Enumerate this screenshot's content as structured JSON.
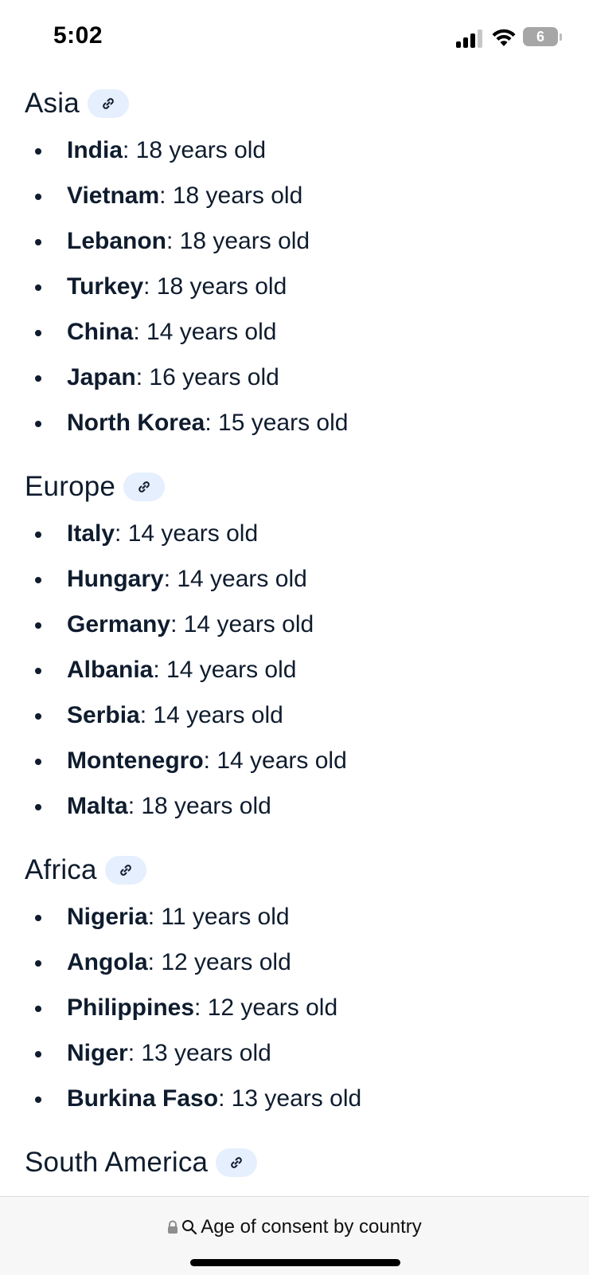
{
  "status_bar": {
    "time": "5:02",
    "battery": "6"
  },
  "sections": [
    {
      "title": "Asia",
      "items": [
        {
          "country": "India",
          "age": ": 18 years old"
        },
        {
          "country": "Vietnam",
          "age": ": 18 years old"
        },
        {
          "country": "Lebanon",
          "age": ": 18 years old"
        },
        {
          "country": "Turkey",
          "age": ": 18 years old"
        },
        {
          "country": "China",
          "age": ": 14 years old"
        },
        {
          "country": "Japan",
          "age": ": 16 years old"
        },
        {
          "country": "North Korea",
          "age": ": 15 years old"
        }
      ]
    },
    {
      "title": "Europe",
      "items": [
        {
          "country": "Italy",
          "age": ": 14 years old"
        },
        {
          "country": "Hungary",
          "age": ": 14 years old"
        },
        {
          "country": "Germany",
          "age": ": 14 years old"
        },
        {
          "country": "Albania",
          "age": ": 14 years old"
        },
        {
          "country": "Serbia",
          "age": ": 14 years old"
        },
        {
          "country": "Montenegro",
          "age": ": 14 years old"
        },
        {
          "country": "Malta",
          "age": ": 18 years old"
        }
      ]
    },
    {
      "title": "Africa",
      "items": [
        {
          "country": "Nigeria",
          "age": ": 11 years old"
        },
        {
          "country": "Angola",
          "age": ": 12 years old"
        },
        {
          "country": "Philippines",
          "age": ": 12 years old"
        },
        {
          "country": "Niger",
          "age": ": 13 years old"
        },
        {
          "country": "Burkina Faso",
          "age": ": 13 years old"
        }
      ]
    },
    {
      "title": "South America",
      "items": []
    }
  ],
  "url_bar": {
    "text": "Age of consent by country"
  },
  "colors": {
    "text": "#0f1c2e",
    "chip_background": "#e5effd",
    "bar_background": "#f7f7f7"
  },
  "icons": {
    "link": "link-icon",
    "lock": "lock-icon",
    "search": "search-icon"
  }
}
